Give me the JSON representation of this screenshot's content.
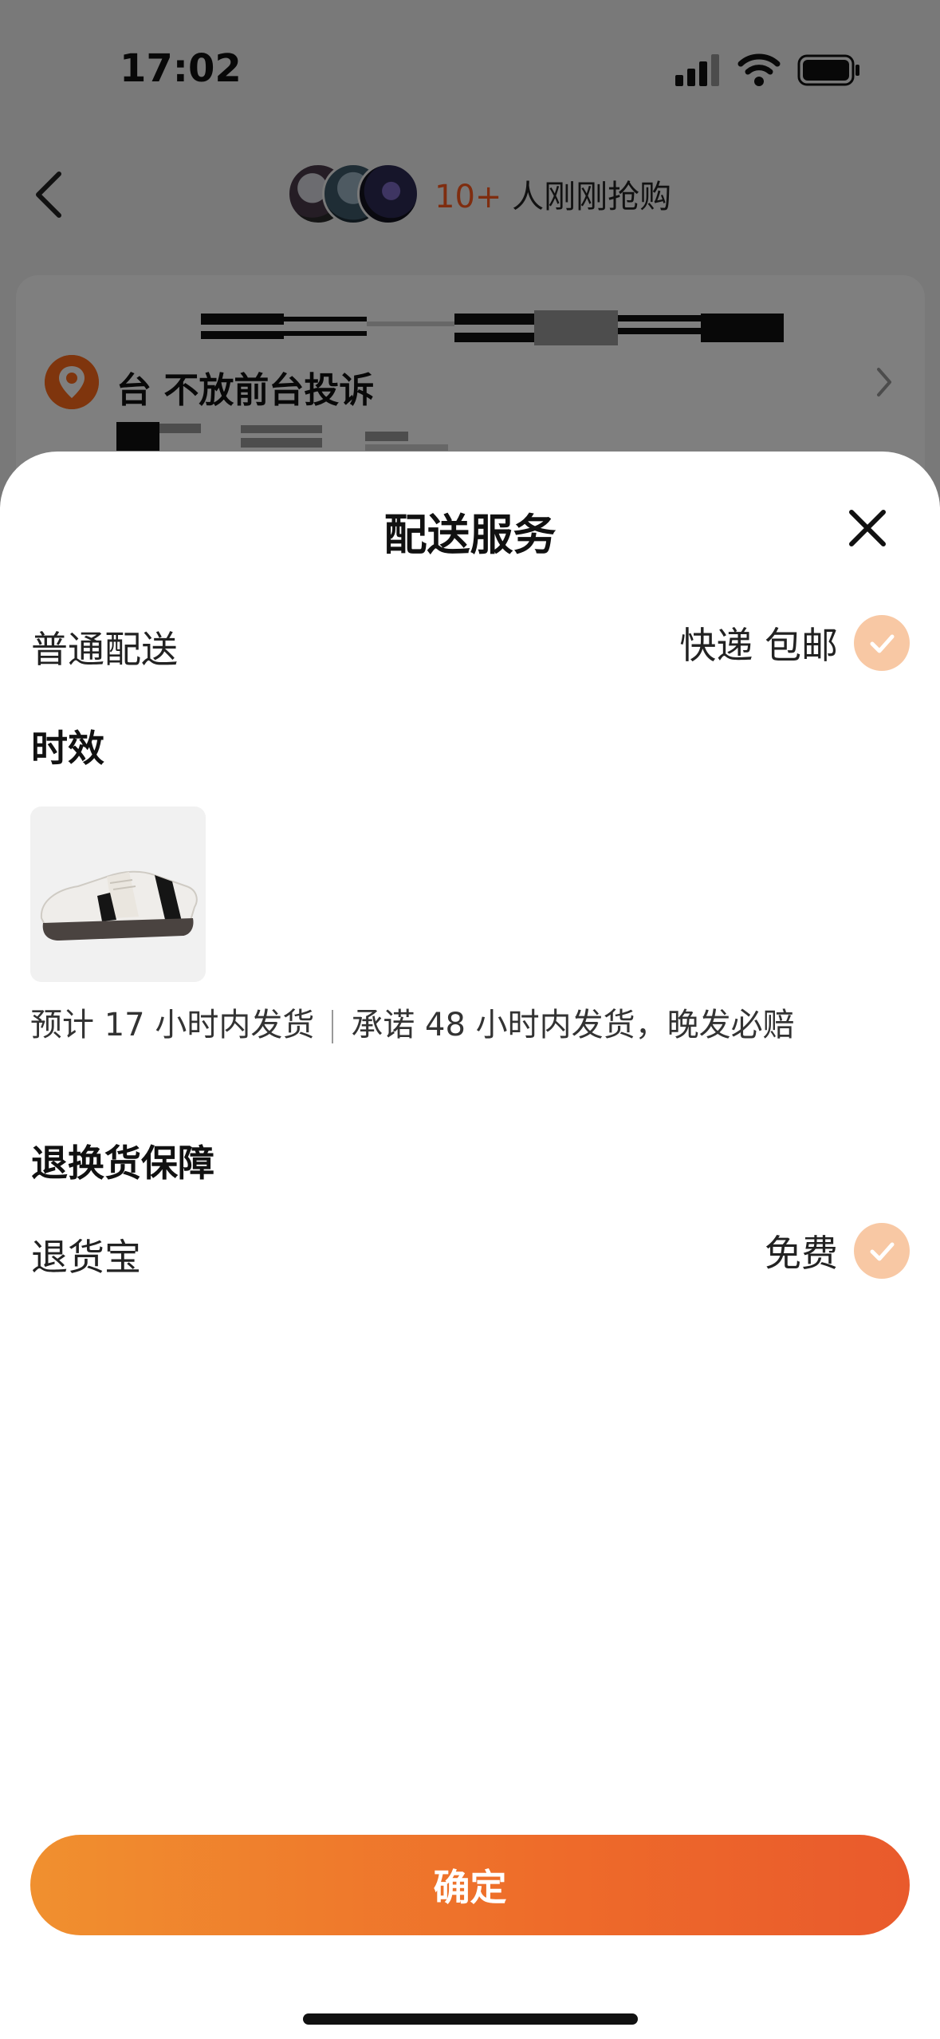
{
  "status_bar": {
    "time": "17:02"
  },
  "top_nav": {
    "buyers_count": "10+",
    "buyers_text": " 人刚刚抢购"
  },
  "address": {
    "text": "台 不放前台投诉"
  },
  "sheet": {
    "title": "配送服务",
    "delivery": {
      "label": "普通配送",
      "value": "快递 包邮",
      "checked": true
    },
    "timeliness": {
      "title": "时效",
      "product_icon": "sneaker-image",
      "estimate": "预计 17 小时内发货",
      "promise": "承诺 48 小时内发货，晚发必赔"
    },
    "returns": {
      "title": "退换货保障",
      "label": "退货宝",
      "value": "免费",
      "checked": true
    },
    "confirm_label": "确定"
  },
  "colors": {
    "accent": "#ff5a1f",
    "check_bg": "#f8c8a4",
    "button_gradient_start": "#f0902f",
    "button_gradient_end": "#e95a2c"
  }
}
